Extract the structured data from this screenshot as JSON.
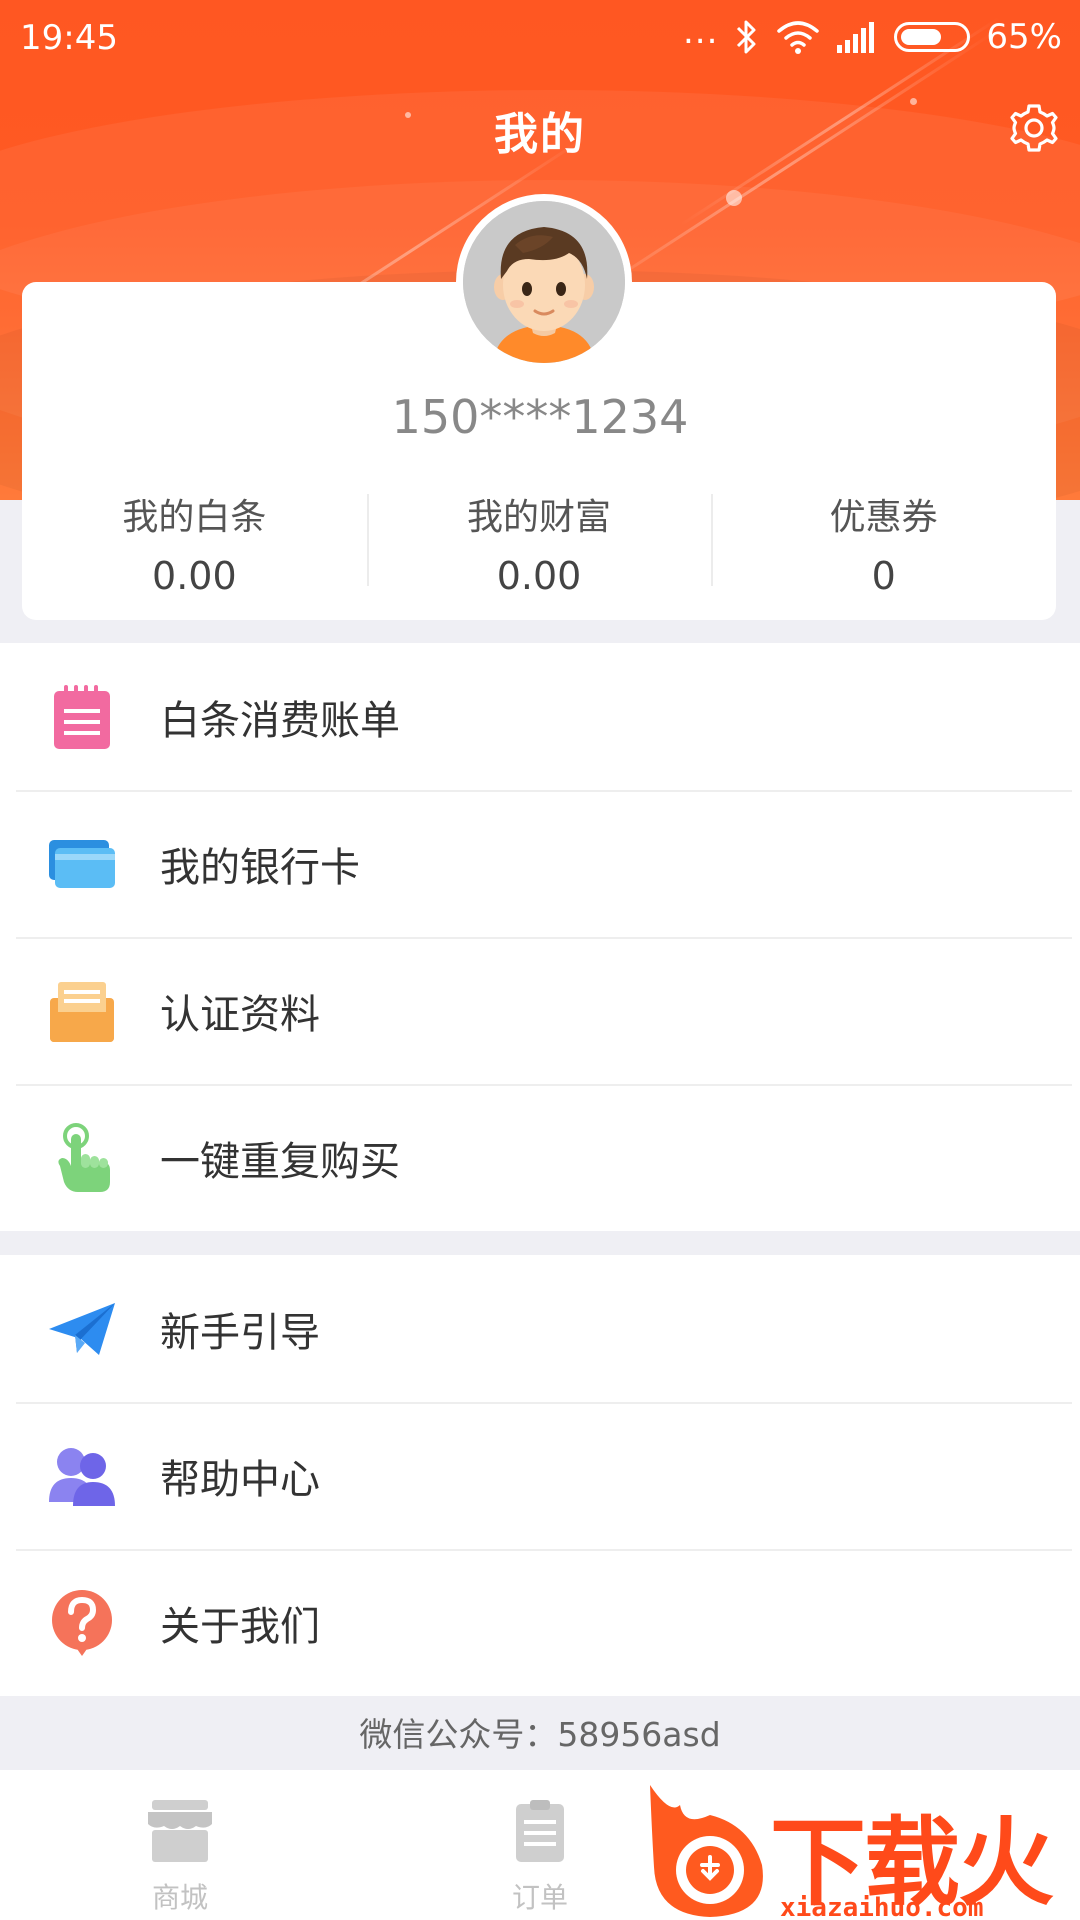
{
  "status_bar": {
    "time": "19:45",
    "dots": "...",
    "battery": "65%"
  },
  "header": {
    "title": "我的"
  },
  "profile": {
    "phone": "150****1234",
    "stats": [
      {
        "label": "我的白条",
        "value": "0.00"
      },
      {
        "label": "我的财富",
        "value": "0.00"
      },
      {
        "label": "优惠券",
        "value": "0"
      }
    ]
  },
  "menu_group_1": [
    {
      "label": "白条消费账单",
      "icon": "bill-icon",
      "color": "#f26aa0"
    },
    {
      "label": "我的银行卡",
      "icon": "bank-card-icon",
      "color": "#4fb0f0"
    },
    {
      "label": "认证资料",
      "icon": "document-icon",
      "color": "#f7a84a"
    },
    {
      "label": "一键重复购买",
      "icon": "tap-hand-icon",
      "color": "#7dd37b"
    }
  ],
  "menu_group_2": [
    {
      "label": "新手引导",
      "icon": "paper-plane-icon",
      "color": "#2d8cf0"
    },
    {
      "label": "帮助中心",
      "icon": "users-icon",
      "color": "#8b83f0"
    },
    {
      "label": "关于我们",
      "icon": "question-icon",
      "color": "#f5735a"
    }
  ],
  "footer": {
    "wechat": "微信公众号：58956asd"
  },
  "tabbar": [
    {
      "label": "商城",
      "icon": "store-icon"
    },
    {
      "label": "订单",
      "icon": "order-icon"
    }
  ],
  "watermark": {
    "text": "下载火",
    "url": "xiazaihuo.com"
  },
  "colors": {
    "accent": "#ff5722",
    "background": "#efeff4"
  }
}
